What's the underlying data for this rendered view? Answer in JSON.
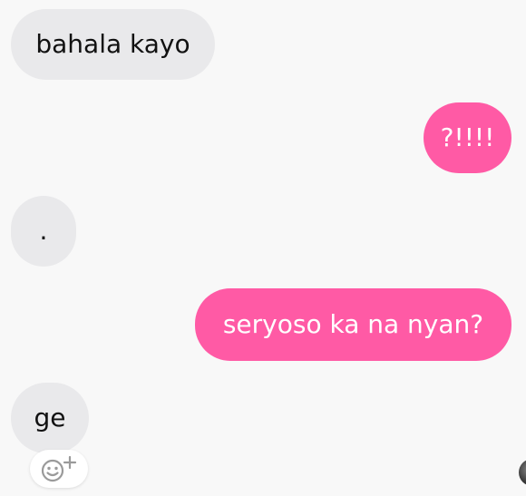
{
  "messages": [
    {
      "direction": "incoming",
      "text": "bahala kayo"
    },
    {
      "direction": "outgoing",
      "text": "?!!!!"
    },
    {
      "direction": "incoming",
      "text": "."
    },
    {
      "direction": "outgoing",
      "text": "seryoso ka na nyan?"
    },
    {
      "direction": "incoming",
      "text": "ge"
    }
  ],
  "reaction_button": {
    "icon": "smiley-plus-icon"
  },
  "avatar": {
    "icon": "avatar"
  },
  "colors": {
    "background": "#f8f8f8",
    "incoming_bubble": "#e9e9eb",
    "outgoing_bubble": "#ff5aa5",
    "incoming_text": "#111111",
    "outgoing_text": "#ffffff"
  }
}
